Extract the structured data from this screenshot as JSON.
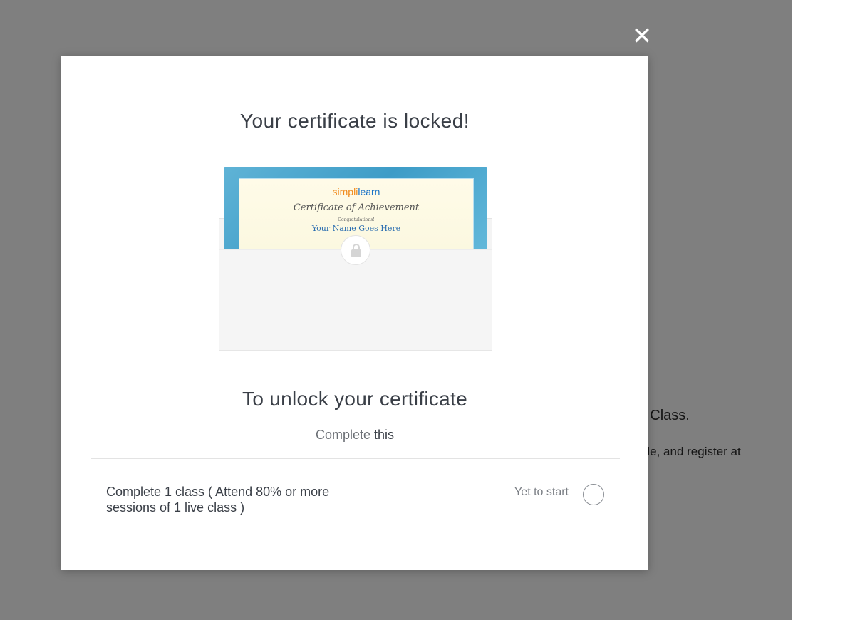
{
  "background": {
    "heading_fragment": "ual Class.",
    "text_fragment": "edule, and register at"
  },
  "modal": {
    "close_glyph": "✕",
    "title": "Your certificate is locked!",
    "certificate": {
      "brand_simpl": "simpl",
      "brand_sep": "i",
      "brand_learn": "learn",
      "heading": "Certificate of Achievement",
      "congrats": "Congratulations!",
      "name": "Your Name Goes Here"
    },
    "unlock_title": "To unlock your certificate",
    "complete_prefix": "Complete",
    "complete_emphasis": "this",
    "requirement": {
      "text": "Complete 1 class ( Attend 80% or more sessions of 1 live class )",
      "status": "Yet to start"
    }
  },
  "colors": {
    "overlay": "#808080",
    "title_text": "#3a3f47",
    "certificate_frame": "#4aa6cf",
    "brand_orange": "#f08a1c",
    "brand_blue": "#1a73c7"
  },
  "icons": {
    "close": "close-icon",
    "lock": "lock-icon",
    "status": "status-circle-icon"
  }
}
